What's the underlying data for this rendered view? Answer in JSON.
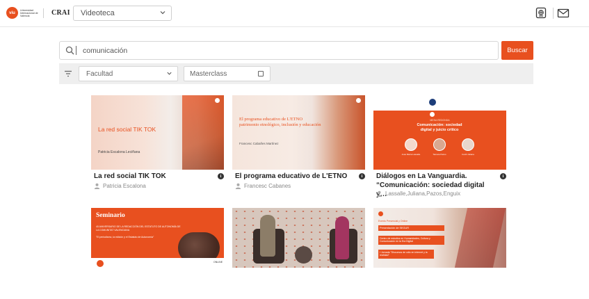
{
  "header": {
    "logo_mark": "viu",
    "logo_text": "Universidad Internacional de Valencia",
    "crai_label": "CRAI",
    "section_selected": "Videoteca",
    "icons": [
      "screen-icon",
      "mail-icon"
    ]
  },
  "search": {
    "value": "comunicación",
    "button_label": "Buscar"
  },
  "filters": {
    "facultad_placeholder": "Facultad",
    "masterclass_label": "Masterclass"
  },
  "cards": [
    {
      "title": "La red social TIK TOK",
      "author": "Patricia Escalona",
      "thumb_heading": "La red social TIK TOK",
      "thumb_sub": "Patricia Escalona Leciñana"
    },
    {
      "title": "El programa educativo de L'ETNO",
      "author": "Francesc Cabanes",
      "thumb_heading": "El programa educativo de L'ETNO patrimonio etnológico, inclusión y educación",
      "thumb_sub": "Francesc Cabañes Martínez"
    },
    {
      "title": "Diálogos en La Vanguardia. “Comunicación: sociedad digital y…",
      "author": "Lassalle,Juliana,Pazos,Enguix",
      "thumb_tag": "MESA REDONDA",
      "thumb_heading": "Comunicación: sociedad digital y juicio crítico",
      "thumb_names": [
        "José María Lassalle",
        "Tamara Pazos",
        "Cecili Juliana"
      ]
    },
    {
      "thumb_heading": "Seminario",
      "thumb_sub": "40 ANIVERSARIO DE LA REDACCIÓN DEL ESTATUTO DE AUTONOMÍA DE LA COMUNITAT VALENCIANA",
      "thumb_quote": "\"El periodismo, la edición y el Estatuto de Autonomía\"",
      "thumb_badge": "ONLINE"
    },
    {
      "thumb_heading": ""
    },
    {
      "thumb_tag": "Evento Presencial y Online",
      "thumb_lines": [
        "Presentación de SEGUR",
        "Centro de estudios en Humanidades, Cultura y Comunicación en la Era Digital",
        "I Jornada \"Discursos de odio en internet y la realidad\""
      ]
    }
  ],
  "colors": {
    "accent": "#e8501f",
    "filter_bg": "#efefef"
  }
}
